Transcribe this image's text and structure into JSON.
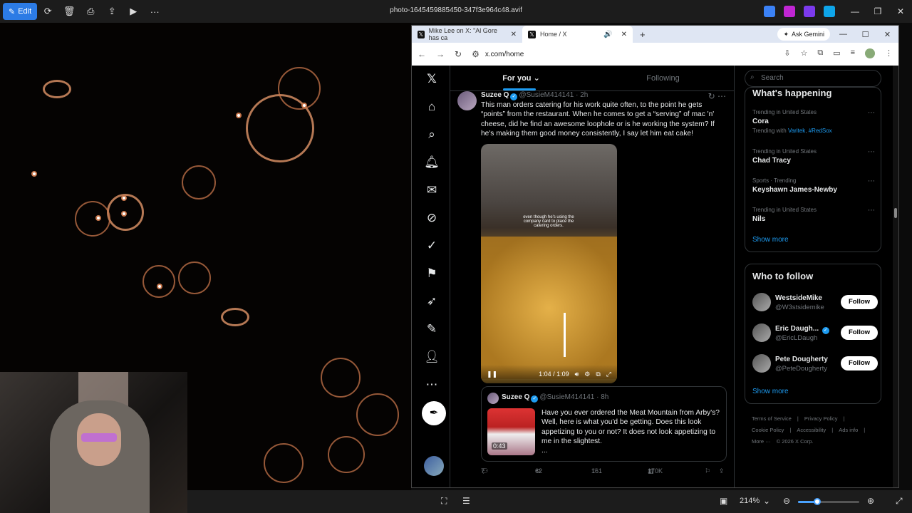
{
  "viewer": {
    "edit_label": "Edit",
    "file_name": "photo-1645459885450-347f3e964c48.avif",
    "zoom": "214%"
  },
  "browser": {
    "tabs": [
      {
        "label": "Mike Lee on X: \"Al Gore has ca",
        "active": false
      },
      {
        "label": "Home / X",
        "active": true
      }
    ],
    "gemini_label": "Ask Gemini",
    "url": "x.com/home"
  },
  "feed": {
    "tabs": [
      {
        "label": "For you"
      },
      {
        "label": "Following"
      }
    ],
    "post": {
      "name": "Suzee Q",
      "handle": "@SusieM414141",
      "time": "· 2h",
      "text": "This man orders catering for his work quite often, to the point he gets “points” from the restaurant. When he comes to get a “serving” of mac 'n' cheese, did he find an awesome loophole or is he working the system? If he's making them good money consistently, I say let him eat cake!",
      "video_caption": "even though he's using the company card to place the catering orders.",
      "video_time": "1:04 / 1:09",
      "quote": {
        "name": "Suzee Q",
        "handle": "@SusieM414141",
        "time": "· 8h",
        "duration": "0:43",
        "text": "Have you ever ordered the Meat Mountain from Arby's? Well, here is what you'd be getting. Does this look appetizing to you or not? It does not look appetizing to me in the slightest.",
        "ellipsis": "..."
      },
      "actions": {
        "replies": "7",
        "reposts": "62",
        "likes": "161",
        "views": "170K"
      }
    }
  },
  "sidebar": {
    "search_placeholder": "Search",
    "whats_happening_title": "What's happening",
    "trends": [
      {
        "category": "Trending in United States",
        "name": "Cora",
        "with_label": "Trending with",
        "with": [
          "Varitek",
          "#RedSox"
        ]
      },
      {
        "category": "Trending in United States",
        "name": "Chad Tracy"
      },
      {
        "category": "Sports · Trending",
        "name": "Keyshawn James-Newby"
      },
      {
        "category": "Trending in United States",
        "name": "Nils"
      }
    ],
    "show_more": "Show more",
    "who_to_follow_title": "Who to follow",
    "follow_label": "Follow",
    "suggestions": [
      {
        "name": "WestsideMike",
        "handle": "@W3stsidemike",
        "verified": false
      },
      {
        "name": "Eric Daugh...",
        "handle": "@EricLDaugh",
        "verified": true
      },
      {
        "name": "Pete Dougherty",
        "handle": "@PeteDougherty",
        "verified": false
      }
    ],
    "footer": [
      "Terms of Service",
      "|",
      "Privacy Policy",
      "|",
      "Cookie Policy",
      "|",
      "Accessibility",
      "|",
      "Ads info",
      "|",
      "More ···",
      "© 2026 X Corp."
    ]
  },
  "colors": {
    "accent": "#1d9bf0",
    "edit_button": "#2c7be5"
  },
  "icons": [
    "x-logo-icon",
    "home-icon",
    "search-icon",
    "bell-icon",
    "message-icon",
    "grok-icon",
    "verified-icon",
    "bookmark-icon",
    "rocket-icon",
    "note-icon",
    "profile-icon",
    "more-icon",
    "post-icon"
  ]
}
